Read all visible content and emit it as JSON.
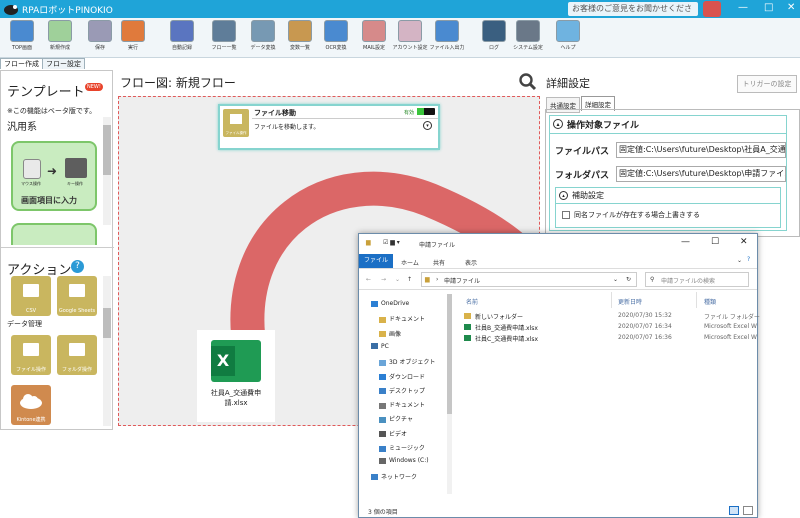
{
  "app": {
    "title": "RPAロボットPINOKIO",
    "feedback": "お客様のご意見をお聞かせください",
    "window_controls": {
      "minimize": "—",
      "restore": "□",
      "close": "✕"
    }
  },
  "ribbon": [
    {
      "label": "TOP画面",
      "icon": "home-icon",
      "color": "#4a8ad0"
    },
    {
      "label": "新規作成",
      "icon": "new-icon",
      "color": "#9fd09a"
    },
    {
      "label": "保存",
      "icon": "save-icon",
      "color": "#9a9ab5"
    },
    {
      "label": "実行",
      "icon": "run-icon",
      "color": "#e07a3c"
    },
    {
      "label": "自動記録",
      "icon": "record-icon",
      "color": "#5a75c0"
    },
    {
      "label": "フロー一覧",
      "icon": "list-icon",
      "color": "#5f7d99"
    },
    {
      "label": "データ変換",
      "icon": "convert-icon",
      "color": "#7799b3"
    },
    {
      "label": "変数一覧",
      "icon": "variable-icon",
      "color": "#c89850"
    },
    {
      "label": "OCR変換",
      "icon": "ocr-icon",
      "color": "#4a8ad0"
    },
    {
      "label": "MAIL設定",
      "icon": "mail-icon",
      "color": "#d68a8a"
    },
    {
      "label": "アカウント設定",
      "icon": "account-icon",
      "color": "#d4b4c4"
    },
    {
      "label": "ファイル入出力",
      "icon": "file-io-icon",
      "color": "#4a8ad0"
    },
    {
      "label": "ログ",
      "icon": "log-icon",
      "color": "#3a5f80"
    },
    {
      "label": "システム設定",
      "icon": "gear-icon",
      "color": "#6a7888"
    },
    {
      "label": "ヘルプ",
      "icon": "help-icon",
      "color": "#6fb3e0"
    }
  ],
  "tabs": {
    "flow_create": "フロー作成",
    "flow_settings": "フロー設定"
  },
  "left": {
    "template_title": "テンプレート",
    "new_badge": "NEW!",
    "beta_note": "※この機能はベータ版です。",
    "category": "汎用系",
    "card_label": "画面項目に入力",
    "card_mouse": "マウス操作",
    "card_keyboard": "キー操作",
    "action_title": "アクション",
    "action_help": "?",
    "tiles_top": [
      {
        "label": "CSV",
        "color": "#c9b65f"
      },
      {
        "label": "Google Sheets",
        "color": "#c9b65f"
      }
    ],
    "data_section": "データ管理",
    "tiles_bottom": [
      {
        "label": "ファイル操作",
        "color": "#c9b65f"
      },
      {
        "label": "フォルダ操作",
        "color": "#c9b65f"
      }
    ],
    "tile_kintone": "Kintone連携"
  },
  "flow": {
    "header": "フロー図:  新規フロー",
    "node_title": "ファイル移動",
    "node_status": "有効",
    "node_desc": "ファイルを移動します。",
    "node_icon_label": "ファイル操作"
  },
  "detail": {
    "title": "詳細設定",
    "trigger_button": "トリガーの設定",
    "tab_common": "共通設定",
    "tab_detail": "詳細設定",
    "section": "操作対象ファイル",
    "file_path_label": "ファイルパス",
    "file_path_value": "固定値:C:\\Users\\future\\Desktop\\社員A_交通",
    "folder_path_label": "フォルダパス",
    "folder_path_value": "固定値:C:\\Users\\future\\Desktop\\申請ファイル",
    "supplement": "補助設定",
    "overwrite_label": "同名ファイルが存在する場合上書きする"
  },
  "dragged_file": {
    "name": "社員A_交通費申請.xlsx",
    "icon_letter": "X"
  },
  "explorer": {
    "title": "申請ファイル",
    "menu": [
      "ファイル",
      "ホーム",
      "共有",
      "表示"
    ],
    "address": "申請ファイル",
    "search_placeholder": "申請ファイルの検索",
    "columns": {
      "name": "名前",
      "date": "更新日時",
      "type": "種類"
    },
    "files": [
      {
        "name": "新しいフォルダー",
        "date": "2020/07/30 15:32",
        "type": "ファイル フォルダー",
        "kind": "folder"
      },
      {
        "name": "社員B_交通費申請.xlsx",
        "date": "2020/07/07 16:34",
        "type": "Microsoft Excel W",
        "kind": "excel"
      },
      {
        "name": "社員C_交通費申請.xlsx",
        "date": "2020/07/07 16:36",
        "type": "Microsoft Excel W",
        "kind": "excel"
      }
    ],
    "tree": [
      {
        "label": "OneDrive",
        "indent": 0,
        "icon": "cloud"
      },
      {
        "label": "ドキュメント",
        "indent": 1,
        "icon": "folder"
      },
      {
        "label": "画像",
        "indent": 1,
        "icon": "folder"
      },
      {
        "label": "PC",
        "indent": 0,
        "icon": "pc"
      },
      {
        "label": "3D オブジェクト",
        "indent": 1,
        "icon": "cube"
      },
      {
        "label": "ダウンロード",
        "indent": 1,
        "icon": "download"
      },
      {
        "label": "デスクトップ",
        "indent": 1,
        "icon": "desktop"
      },
      {
        "label": "ドキュメント",
        "indent": 1,
        "icon": "doc"
      },
      {
        "label": "ピクチャ",
        "indent": 1,
        "icon": "picture"
      },
      {
        "label": "ビデオ",
        "indent": 1,
        "icon": "video"
      },
      {
        "label": "ミュージック",
        "indent": 1,
        "icon": "music"
      },
      {
        "label": "Windows (C:)",
        "indent": 1,
        "icon": "drive"
      },
      {
        "label": "ネットワーク",
        "indent": 0,
        "icon": "network"
      }
    ],
    "status": "3 個の項目"
  },
  "colors": {
    "accent": "#1fa4d8",
    "arrow": "#d95f5f",
    "teal": "#86d4cf",
    "green": "#7dc66a"
  }
}
